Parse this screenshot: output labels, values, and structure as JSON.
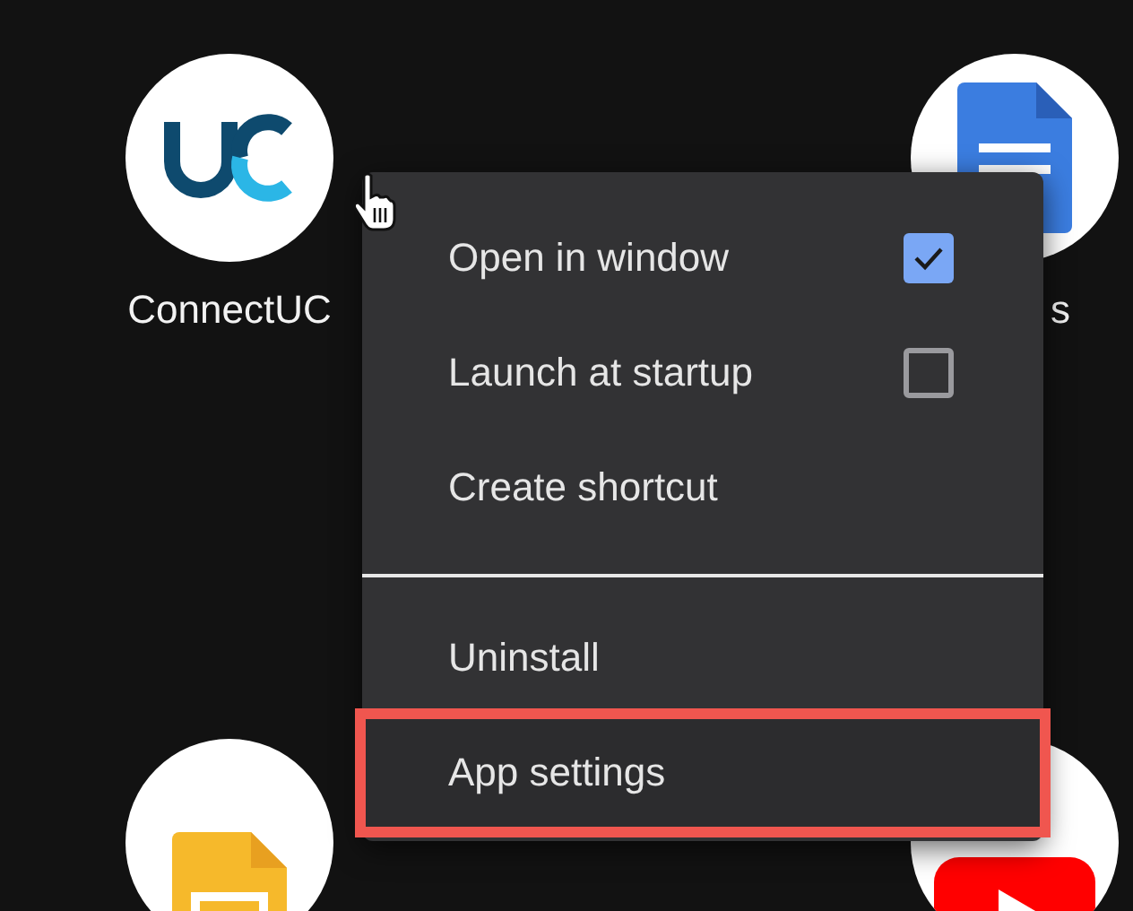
{
  "apps": [
    {
      "kind": "connectuc",
      "label": "ConnectUC"
    },
    {
      "kind": "docs",
      "label": "s"
    },
    {
      "kind": "slides"
    },
    {
      "kind": "youtube"
    }
  ],
  "context_menu": {
    "sections": [
      {
        "items": [
          {
            "kind": "checkbox",
            "label": "Open in window",
            "checked": true,
            "highlighted": false
          },
          {
            "kind": "checkbox",
            "label": "Launch at startup",
            "checked": false,
            "highlighted": false
          },
          {
            "kind": "action",
            "label": "Create shortcut",
            "highlighted": false
          }
        ]
      },
      {
        "items": [
          {
            "kind": "action",
            "label": "Uninstall",
            "highlighted": false
          },
          {
            "kind": "action",
            "label": "App settings",
            "highlighted": true
          }
        ]
      }
    ]
  }
}
